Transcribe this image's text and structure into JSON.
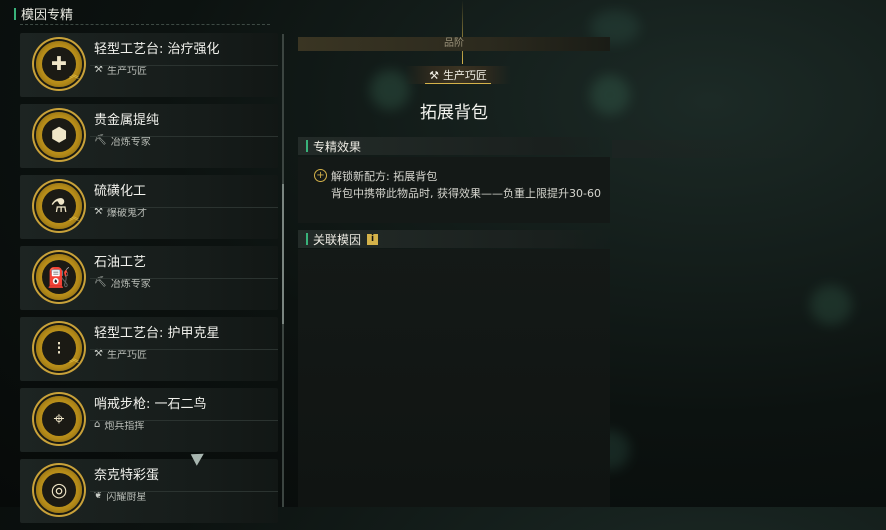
{
  "panel_title": "模因专精",
  "items": [
    {
      "name": "轻型工艺台: 治疗强化",
      "category": "生产巧匠",
      "cat_icon": "tools-icon",
      "glyph": "✚",
      "chev": "︽"
    },
    {
      "name": "贵金属提纯",
      "category": "冶炼专家",
      "cat_icon": "pickaxe-icon",
      "glyph": "⬢",
      "chev": ""
    },
    {
      "name": "硫磺化工",
      "category": "爆破鬼才",
      "cat_icon": "tools-icon",
      "glyph": "⚗",
      "chev": "︽"
    },
    {
      "name": "石油工艺",
      "category": "冶炼专家",
      "cat_icon": "pickaxe-icon",
      "glyph": "⛽",
      "chev": ""
    },
    {
      "name": "轻型工艺台: 护甲克星",
      "category": "生产巧匠",
      "cat_icon": "tools-icon",
      "glyph": "⁝",
      "chev": "︽"
    },
    {
      "name": "哨戒步枪: 一石二鸟",
      "category": "炮兵指挥",
      "cat_icon": "artillery-icon",
      "glyph": "⌖",
      "chev": ""
    },
    {
      "name": "奈克特彩蛋",
      "category": "闪耀厨星",
      "cat_icon": "wing-icon",
      "glyph": "◎",
      "chev": ""
    }
  ],
  "detail": {
    "grade_label": "品阶",
    "tag": "生产巧匠",
    "title": "拓展背包",
    "effect_header": "专精效果",
    "effect_line1": "解锁新配方: 拓展背包",
    "effect_line2": "背包中携带此物品时, 获得效果——负重上限提升30-60",
    "related_header": "关联模因"
  },
  "colors": {
    "accent_gold": "#d4b24a",
    "accent_green": "#39b27a"
  }
}
